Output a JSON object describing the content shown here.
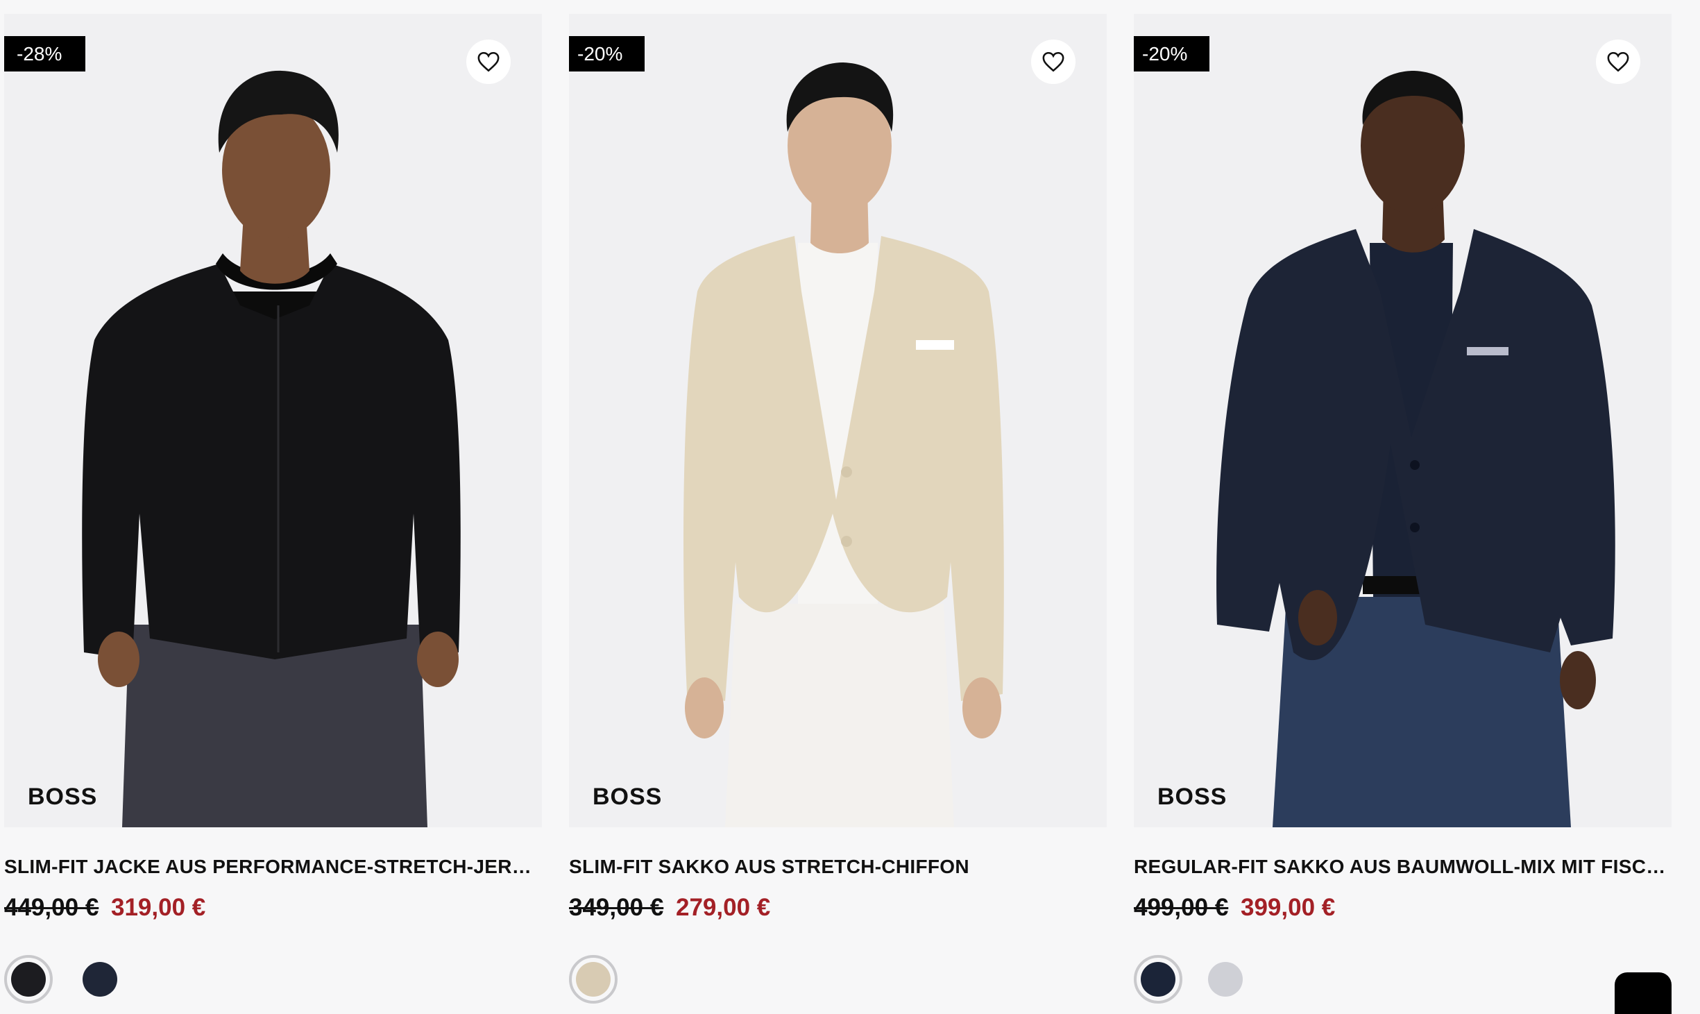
{
  "products": [
    {
      "discount": "-28%",
      "brand": "BOSS",
      "name": "SLIM-FIT JACKE AUS PERFORMANCE-STRETCH-JERSEY",
      "old_price": "449,00 €",
      "new_price": "319,00 €",
      "swatches": [
        {
          "color": "#1c1c20",
          "selected": true
        },
        {
          "color": "#1f2637",
          "selected": false
        }
      ],
      "colors": {
        "jacket": "#141416",
        "trousers": "#3a3a44",
        "skin": "#7a5036",
        "hair": "#151515",
        "shirt": "#0c0c0c"
      }
    },
    {
      "discount": "-20%",
      "brand": "BOSS",
      "name": "SLIM-FIT SAKKO AUS STRETCH-CHIFFON",
      "old_price": "349,00 €",
      "new_price": "279,00 €",
      "swatches": [
        {
          "color": "#d8cbb3",
          "selected": true
        }
      ],
      "colors": {
        "jacket": "#e2d6bc",
        "trousers": "#f3f1ee",
        "skin": "#d6b296",
        "hair": "#141414",
        "shirt": "#f6f5f3"
      }
    },
    {
      "discount": "-20%",
      "brand": "BOSS",
      "name": "REGULAR-FIT SAKKO AUS BAUMWOLL-MIX MIT FISCHG...",
      "old_price": "499,00 €",
      "new_price": "399,00 €",
      "swatches": [
        {
          "color": "#1b2438",
          "selected": true
        },
        {
          "color": "#cfd0d6",
          "selected": false
        }
      ],
      "colors": {
        "jacket": "#1d2436",
        "trousers": "#2c3d5c",
        "skin": "#4a2e20",
        "hair": "#121212",
        "shirt": "#1a2235"
      }
    }
  ],
  "icons": {
    "wishlist": "heart-icon",
    "chat": "chat-icon"
  }
}
